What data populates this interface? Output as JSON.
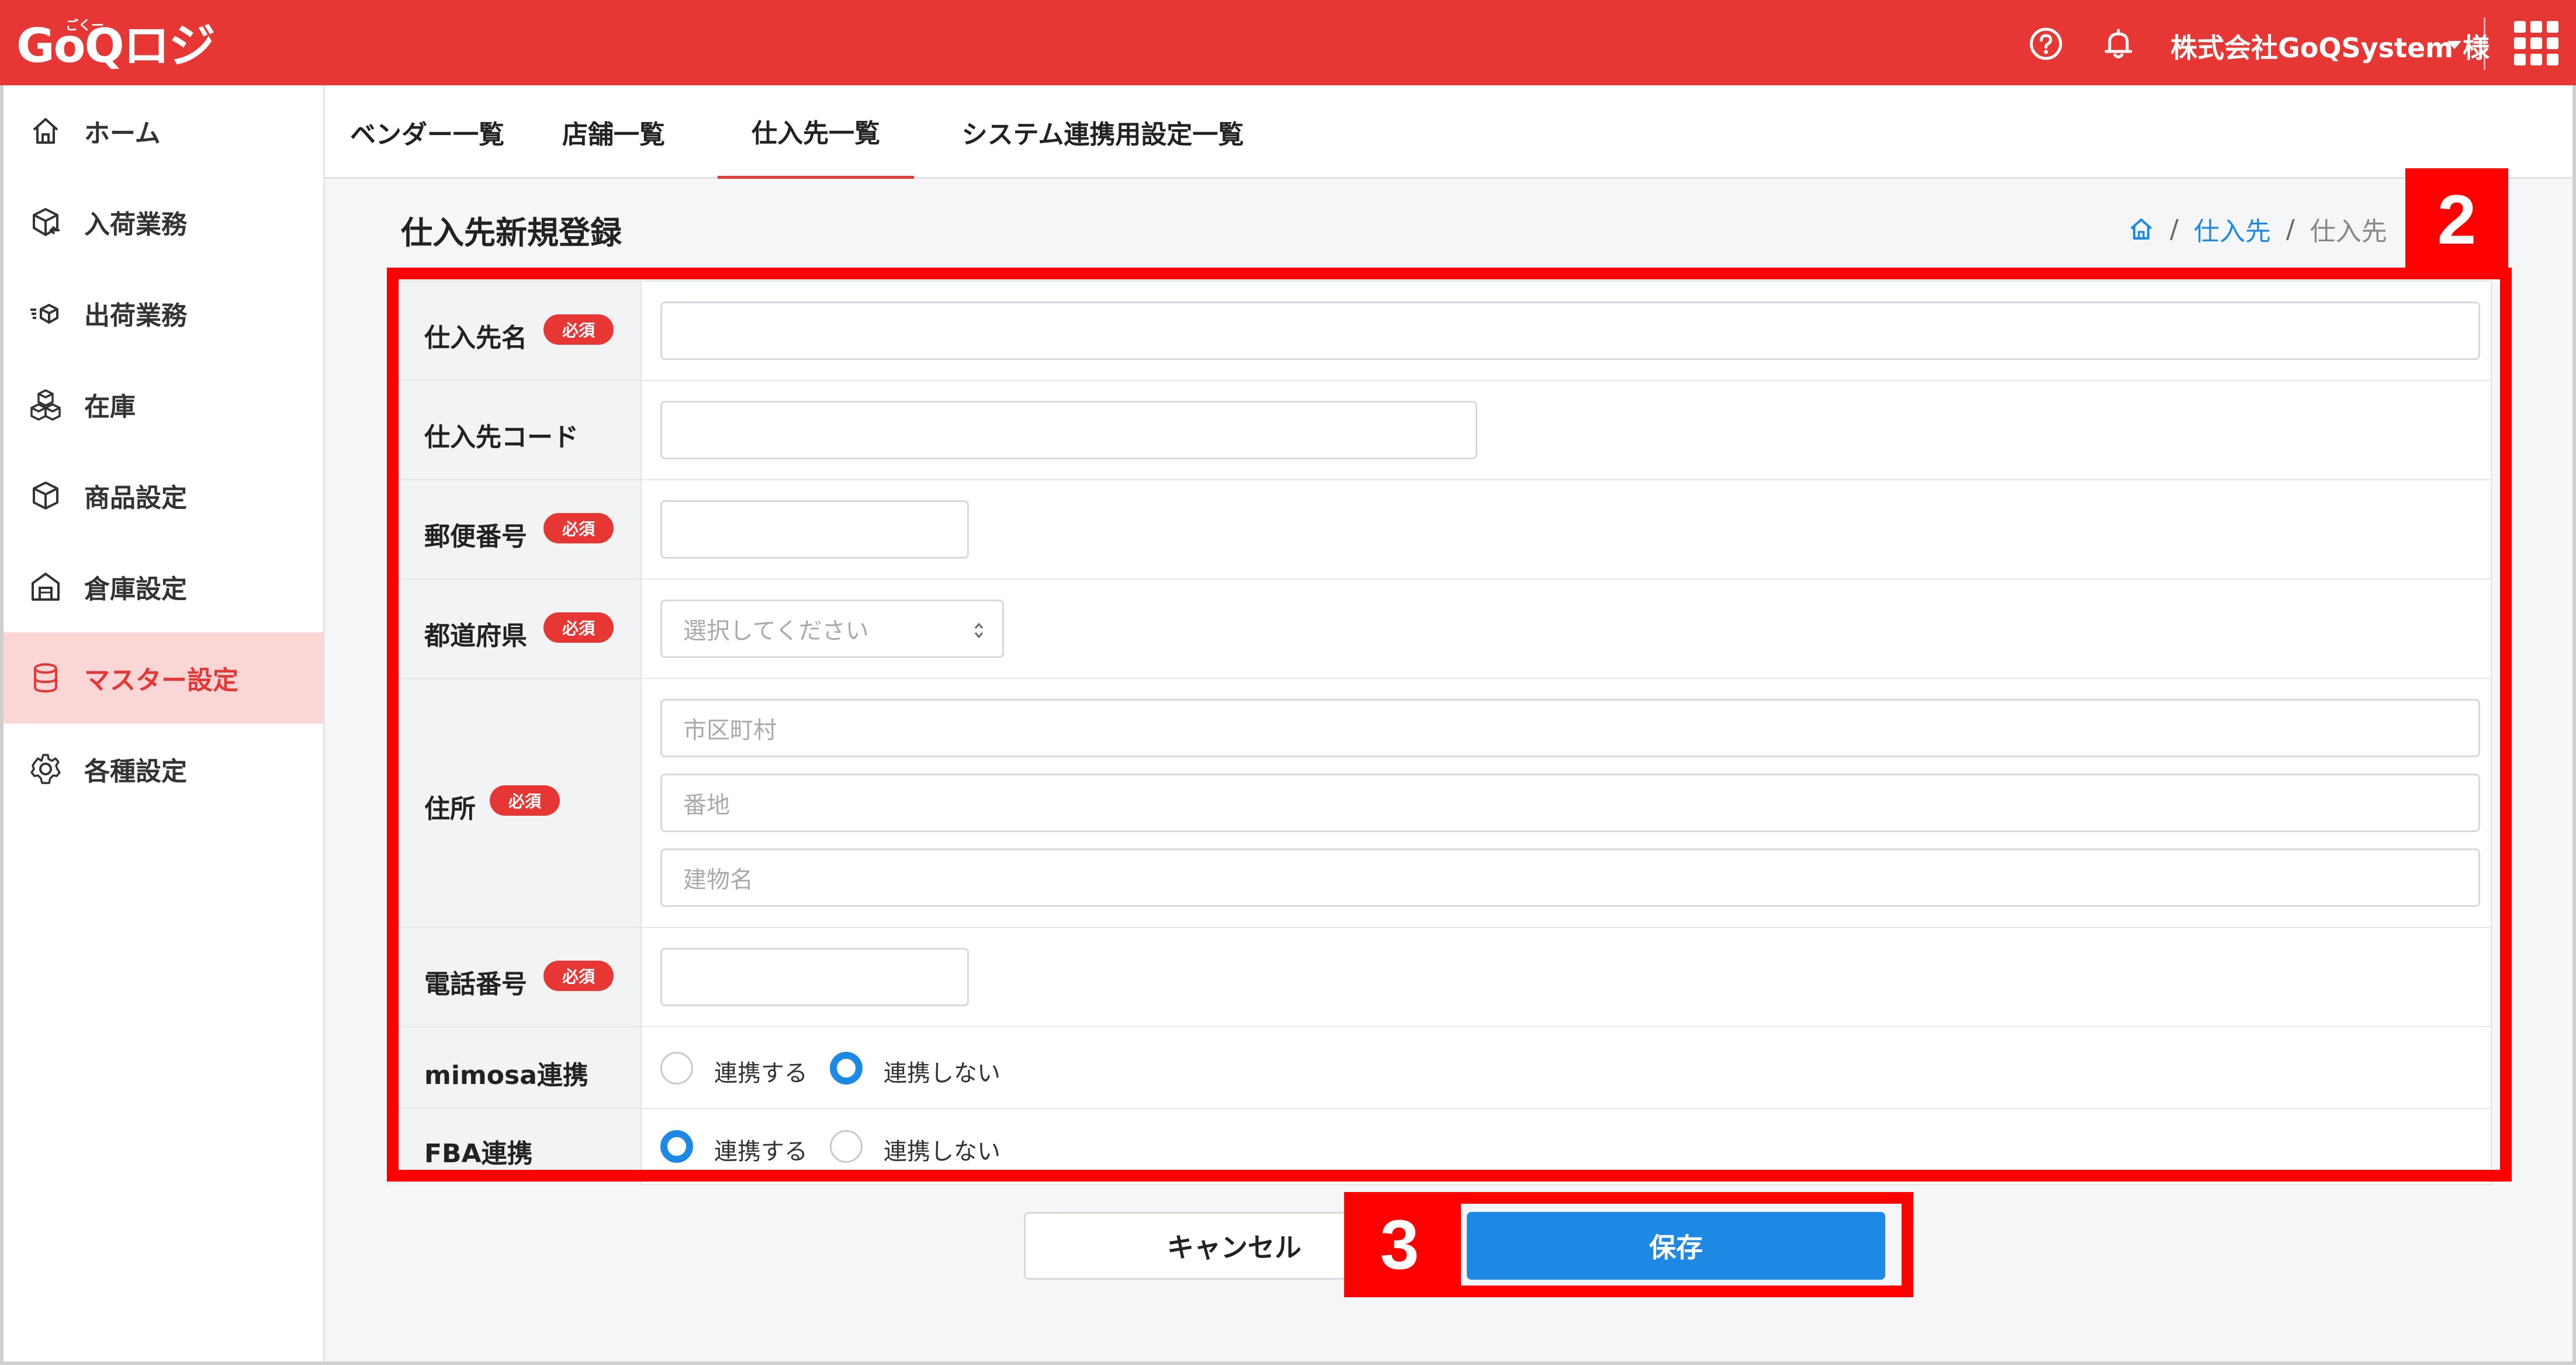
{
  "header": {
    "logo": "GoQロジ",
    "logo_ruby": "ごくー",
    "user": "株式会社GoQSystem 様",
    "colors": {
      "brand": "#e63735",
      "accent": "#1e88e5"
    },
    "icons": [
      "help-icon",
      "bell-icon",
      "app-grid-icon"
    ]
  },
  "sidebar": {
    "items": [
      {
        "label": "ホーム",
        "icon": "home-icon"
      },
      {
        "label": "入荷業務",
        "icon": "inbound-box-icon"
      },
      {
        "label": "出荷業務",
        "icon": "outbound-box-icon"
      },
      {
        "label": "在庫",
        "icon": "stock-boxes-icon"
      },
      {
        "label": "商品設定",
        "icon": "product-box-icon"
      },
      {
        "label": "倉庫設定",
        "icon": "warehouse-icon"
      },
      {
        "label": "マスター設定",
        "icon": "database-icon",
        "active": true
      },
      {
        "label": "各種設定",
        "icon": "gear-icon"
      }
    ]
  },
  "tabs": [
    {
      "label": "ベンダー一覧"
    },
    {
      "label": "店舗一覧"
    },
    {
      "label": "仕入先一覧",
      "active": true
    },
    {
      "label": "システム連携用設定一覧"
    }
  ],
  "page": {
    "title": "仕入先新規登録",
    "breadcrumb": {
      "link": "仕入先",
      "current": "仕入先"
    }
  },
  "form": {
    "required_badge": "必須",
    "vendor_name": {
      "label": "仕入先名",
      "value": ""
    },
    "vendor_code": {
      "label": "仕入先コード",
      "value": ""
    },
    "postal_code": {
      "label": "郵便番号",
      "value": ""
    },
    "prefecture": {
      "label": "都道府県",
      "placeholder": "選択してください"
    },
    "address": {
      "label": "住所",
      "city_placeholder": "市区町村",
      "street_placeholder": "番地",
      "building_placeholder": "建物名"
    },
    "phone": {
      "label": "電話番号",
      "value": ""
    },
    "mimosa": {
      "label": "mimosa連携",
      "options": [
        "連携する",
        "連携しない"
      ],
      "selected": "連携しない"
    },
    "fba": {
      "label": "FBA連携",
      "options": [
        "連携する",
        "連携しない"
      ],
      "selected": "連携する"
    }
  },
  "actions": {
    "cancel": "キャンセル",
    "save": "保存"
  },
  "callouts": {
    "form": "2",
    "save": "3"
  }
}
